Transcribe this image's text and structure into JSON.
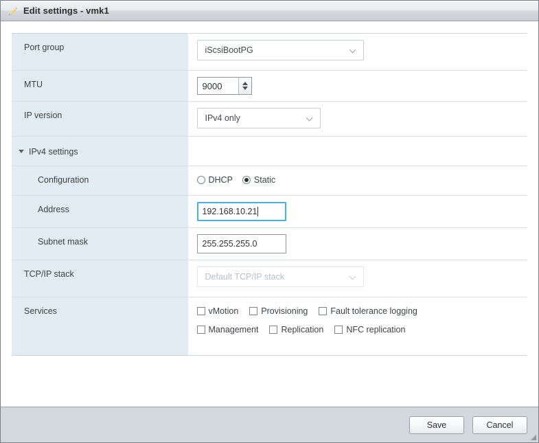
{
  "window": {
    "title": "Edit settings - vmk1",
    "icon": "pencil-icon"
  },
  "form": {
    "rows": [
      {
        "label": "Port group"
      },
      {
        "label": "MTU"
      },
      {
        "label": "IP version"
      },
      {
        "label": "IPv4 settings"
      },
      {
        "label": "Configuration"
      },
      {
        "label": "Address"
      },
      {
        "label": "Subnet mask"
      },
      {
        "label": "TCP/IP stack"
      },
      {
        "label": "Services"
      }
    ],
    "port_group": {
      "label": "Port group",
      "selected": "iScsiBootPG",
      "icon": "chevron-down-icon"
    },
    "mtu": {
      "label": "MTU",
      "value": "9000"
    },
    "ip_version": {
      "label": "IP version",
      "selected": "IPv4 only",
      "icon": "chevron-down-icon"
    },
    "ipv4_settings": {
      "label": "IPv4 settings",
      "expanded": true,
      "icon": "triangle-down-icon"
    },
    "configuration": {
      "label": "Configuration",
      "options": [
        {
          "label": "DHCP",
          "selected": false
        },
        {
          "label": "Static",
          "selected": true
        }
      ]
    },
    "address": {
      "label": "Address",
      "value": "192.168.10.21",
      "focused": true
    },
    "subnet_mask": {
      "label": "Subnet mask",
      "value": "255.255.255.0",
      "focused": false
    },
    "tcpip_stack": {
      "label": "TCP/IP stack",
      "selected": "Default TCP/IP stack",
      "disabled": true,
      "icon": "chevron-down-icon"
    },
    "services": {
      "label": "Services",
      "row1": [
        {
          "label": "vMotion",
          "checked": false
        },
        {
          "label": "Provisioning",
          "checked": false
        },
        {
          "label": "Fault tolerance logging",
          "checked": false
        }
      ],
      "row2": [
        {
          "label": "Management",
          "checked": false
        },
        {
          "label": "Replication",
          "checked": false
        },
        {
          "label": "NFC replication",
          "checked": false
        }
      ]
    }
  },
  "footer": {
    "save_label": "Save",
    "cancel_label": "Cancel"
  },
  "colors": {
    "label_column": "#e1ecf4",
    "focus_border": "#46b2e8",
    "footer_bg": "#d3d8de",
    "pencil": "#f0c040"
  }
}
